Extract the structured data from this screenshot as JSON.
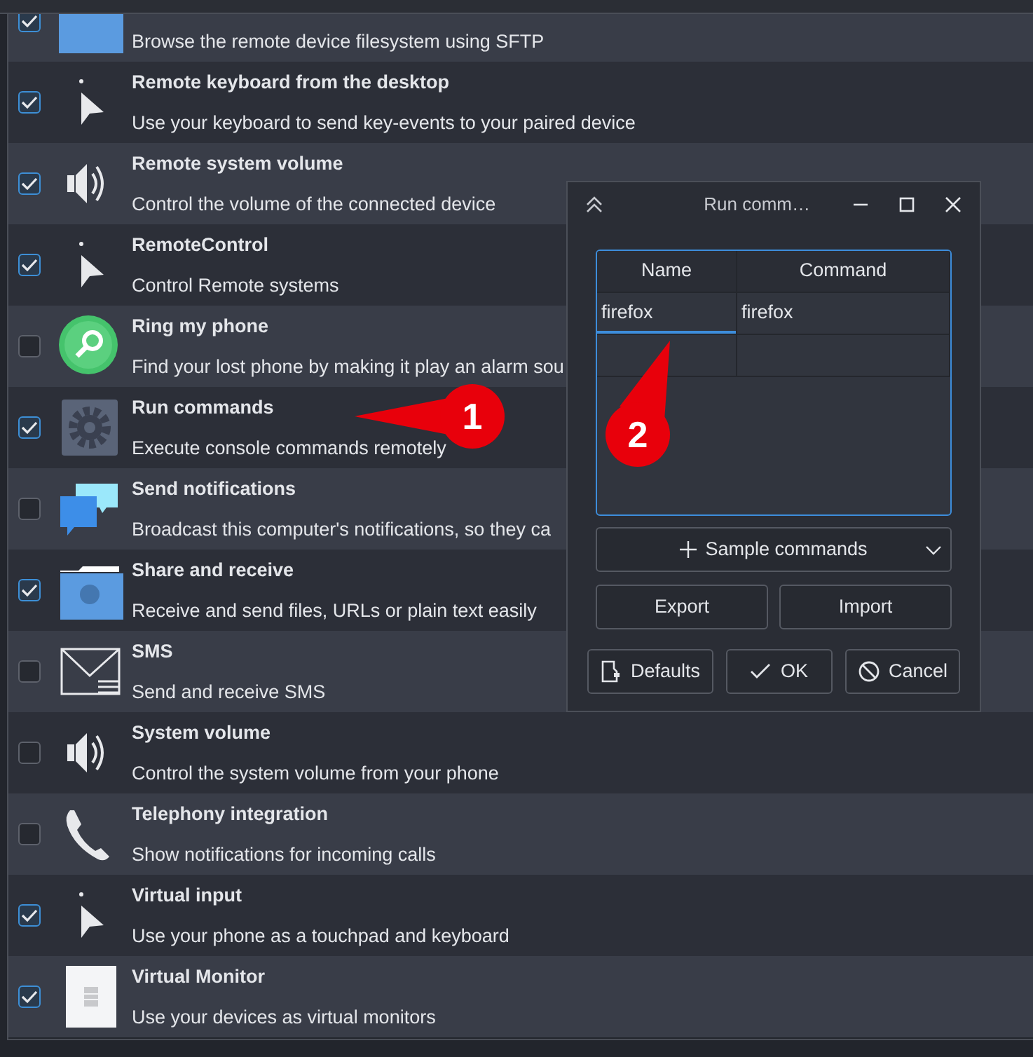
{
  "plugins": [
    {
      "kind": "file",
      "checked": true,
      "description": "Browse the remote device filesystem using SFTP"
    },
    {
      "kind": "pointer",
      "checked": true,
      "title": "Remote keyboard from the desktop",
      "description": "Use your keyboard to send key-events to your paired device"
    },
    {
      "kind": "speaker",
      "checked": true,
      "title": "Remote system volume",
      "description": "Control the volume of the connected device"
    },
    {
      "kind": "pointer",
      "checked": true,
      "title": "RemoteControl",
      "description": "Control Remote systems"
    },
    {
      "kind": "find",
      "checked": false,
      "title": "Ring my phone",
      "description": "Find your lost phone by making it play an alarm sou"
    },
    {
      "kind": "gear",
      "checked": true,
      "title": "Run commands",
      "description": "Execute console commands remotely"
    },
    {
      "kind": "chat",
      "checked": false,
      "title": "Send notifications",
      "description": "Broadcast this computer's notifications, so they ca"
    },
    {
      "kind": "folder",
      "checked": true,
      "title": "Share and receive",
      "description": "Receive and send files, URLs or plain text easily"
    },
    {
      "kind": "envelope",
      "checked": false,
      "title": "SMS",
      "description": "Send and receive SMS"
    },
    {
      "kind": "speaker",
      "checked": false,
      "title": "System volume",
      "description": "Control the system volume from your phone"
    },
    {
      "kind": "phone",
      "checked": false,
      "title": "Telephony integration",
      "description": "Show notifications for incoming calls"
    },
    {
      "kind": "pointer",
      "checked": true,
      "title": "Virtual input",
      "description": "Use your phone as a touchpad and keyboard"
    },
    {
      "kind": "monitor",
      "checked": true,
      "title": "Virtual Monitor",
      "description": "Use your devices as virtual monitors"
    }
  ],
  "dialog": {
    "title": "Run comm…",
    "table": {
      "columns": [
        "Name",
        "Command"
      ],
      "rows": [
        {
          "cells": [
            {
              "text": "firefox",
              "selected": true
            },
            {
              "text": "firefox",
              "selected": false
            }
          ]
        }
      ]
    },
    "sample_button": "Sample commands",
    "buttons_row": [
      "Export",
      "Import"
    ],
    "footer_buttons": [
      {
        "kind": "defaults",
        "label": "Defaults"
      },
      {
        "kind": "ok",
        "label": "OK"
      },
      {
        "kind": "cancel",
        "label": "Cancel"
      }
    ]
  },
  "annotations": [
    "1",
    "2"
  ]
}
